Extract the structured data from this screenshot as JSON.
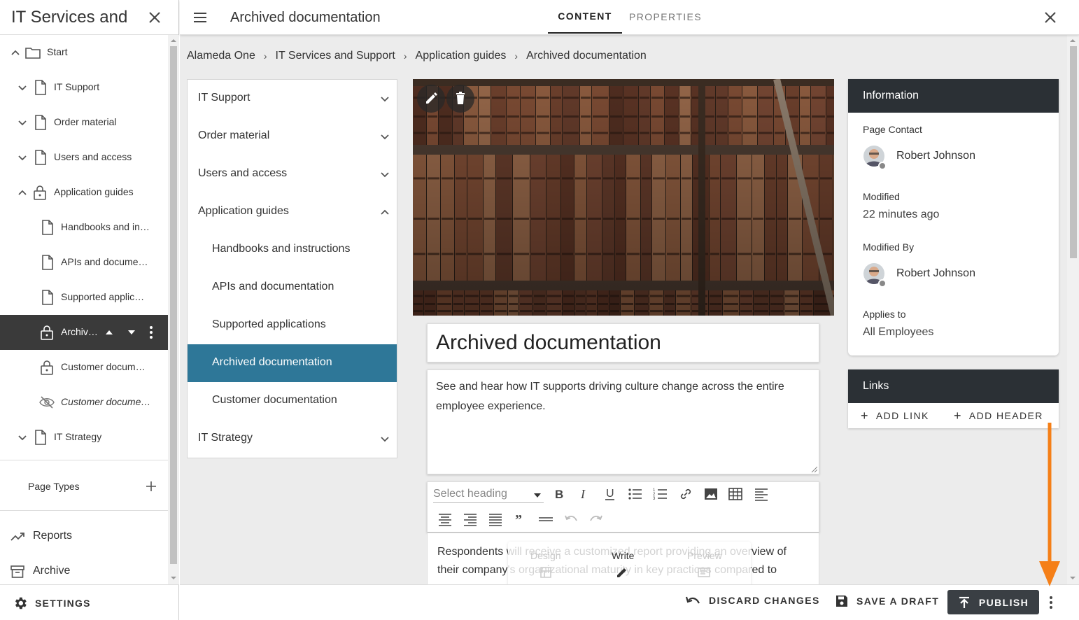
{
  "left_panel": {
    "title": "IT Services and Support",
    "tree": [
      {
        "label": "Start",
        "icon": "folder-icon",
        "chev": "up"
      },
      {
        "label": "IT Support",
        "icon": "page-icon",
        "chev": "down"
      },
      {
        "label": "Order material",
        "icon": "page-icon",
        "chev": "down"
      },
      {
        "label": "Users and access",
        "icon": "page-icon",
        "chev": "down"
      },
      {
        "label": "Application guides",
        "icon": "lock-icon",
        "chev": "up"
      },
      {
        "label": "Handbooks and in…",
        "icon": "page-icon"
      },
      {
        "label": "APIs and docume…",
        "icon": "page-icon"
      },
      {
        "label": "Supported applic…",
        "icon": "page-icon"
      },
      {
        "label": "Archive…",
        "icon": "lock-icon"
      },
      {
        "label": "Customer docum…",
        "icon": "lock-icon"
      },
      {
        "label": "Customer docume…",
        "icon": "eye-off-icon"
      },
      {
        "label": "IT Strategy",
        "icon": "page-icon",
        "chev": "down"
      }
    ],
    "page_types": "Page Types",
    "reports": "Reports",
    "archive": "Archive",
    "settings": "SETTINGS"
  },
  "topbar": {
    "title": "Archived documentation",
    "tabs": [
      "CONTENT",
      "PROPERTIES"
    ]
  },
  "breadcrumb": [
    "Alameda One",
    "IT Services and Support",
    "Application guides",
    "Archived documentation"
  ],
  "nav": [
    {
      "label": "IT Support",
      "chev": "down"
    },
    {
      "label": "Order material",
      "chev": "down"
    },
    {
      "label": "Users and access",
      "chev": "down"
    },
    {
      "label": "Application guides",
      "chev": "up"
    },
    {
      "label": "Handbooks and instructions"
    },
    {
      "label": "APIs and documentation"
    },
    {
      "label": "Supported applications"
    },
    {
      "label": "Archived documentation"
    },
    {
      "label": "Customer documentation"
    },
    {
      "label": "IT Strategy",
      "chev": "down"
    }
  ],
  "editor": {
    "title": "Archived documentation",
    "description": "See and hear how IT supports driving culture change across the entire employee experience.",
    "heading_placeholder": "Select heading",
    "body": "Respondents will receive a customized report providing an overview of their company's organizational maturity in key practices compared to",
    "modes": [
      "Design",
      "Write",
      "Preview"
    ]
  },
  "info": {
    "header": "Information",
    "page_contact_label": "Page Contact",
    "page_contact": "Robert Johnson",
    "modified_label": "Modified",
    "modified": "22 minutes ago",
    "modified_by_label": "Modified By",
    "modified_by": "Robert Johnson",
    "applies_to_label": "Applies to",
    "applies_to": "All Employees"
  },
  "links": {
    "header": "Links",
    "add_link": "ADD LINK",
    "add_header": "ADD HEADER"
  },
  "bottombar": {
    "discard": "DISCARD CHANGES",
    "save_draft": "SAVE A DRAFT",
    "publish": "PUBLISH"
  },
  "colors": {
    "active_nav": "#2e7798",
    "dark_header": "#2b3035",
    "annotation_arrow": "#f57f17"
  }
}
